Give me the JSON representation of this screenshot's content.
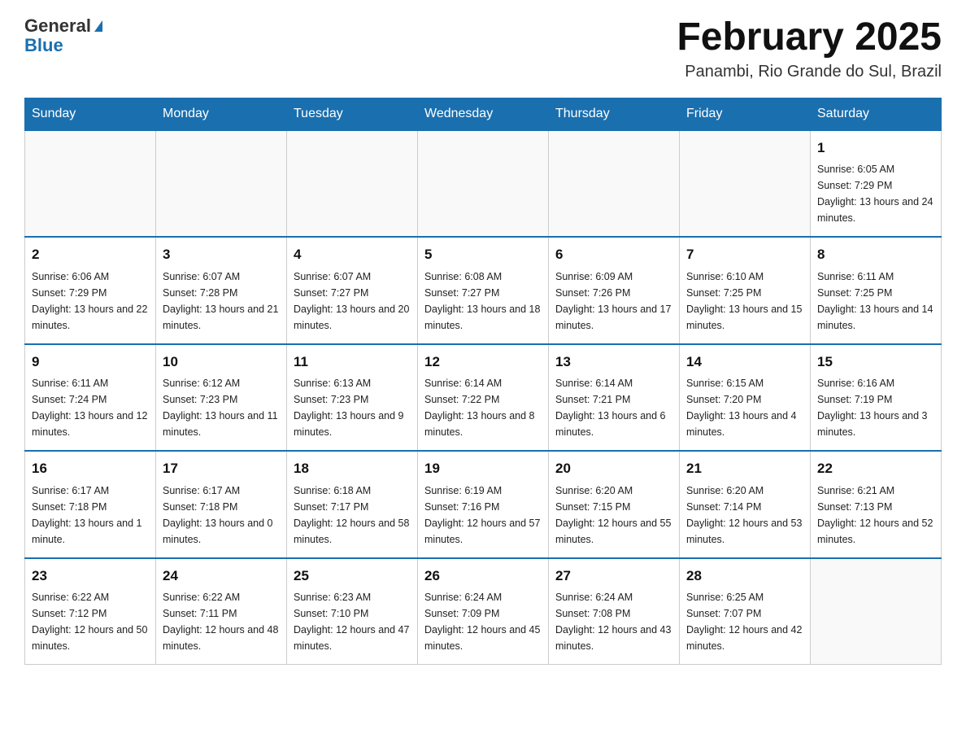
{
  "header": {
    "logo_general": "General",
    "logo_blue": "Blue",
    "title": "February 2025",
    "subtitle": "Panambi, Rio Grande do Sul, Brazil"
  },
  "days_of_week": [
    "Sunday",
    "Monday",
    "Tuesday",
    "Wednesday",
    "Thursday",
    "Friday",
    "Saturday"
  ],
  "weeks": [
    [
      {
        "day": "",
        "info": ""
      },
      {
        "day": "",
        "info": ""
      },
      {
        "day": "",
        "info": ""
      },
      {
        "day": "",
        "info": ""
      },
      {
        "day": "",
        "info": ""
      },
      {
        "day": "",
        "info": ""
      },
      {
        "day": "1",
        "info": "Sunrise: 6:05 AM\nSunset: 7:29 PM\nDaylight: 13 hours and 24 minutes."
      }
    ],
    [
      {
        "day": "2",
        "info": "Sunrise: 6:06 AM\nSunset: 7:29 PM\nDaylight: 13 hours and 22 minutes."
      },
      {
        "day": "3",
        "info": "Sunrise: 6:07 AM\nSunset: 7:28 PM\nDaylight: 13 hours and 21 minutes."
      },
      {
        "day": "4",
        "info": "Sunrise: 6:07 AM\nSunset: 7:27 PM\nDaylight: 13 hours and 20 minutes."
      },
      {
        "day": "5",
        "info": "Sunrise: 6:08 AM\nSunset: 7:27 PM\nDaylight: 13 hours and 18 minutes."
      },
      {
        "day": "6",
        "info": "Sunrise: 6:09 AM\nSunset: 7:26 PM\nDaylight: 13 hours and 17 minutes."
      },
      {
        "day": "7",
        "info": "Sunrise: 6:10 AM\nSunset: 7:25 PM\nDaylight: 13 hours and 15 minutes."
      },
      {
        "day": "8",
        "info": "Sunrise: 6:11 AM\nSunset: 7:25 PM\nDaylight: 13 hours and 14 minutes."
      }
    ],
    [
      {
        "day": "9",
        "info": "Sunrise: 6:11 AM\nSunset: 7:24 PM\nDaylight: 13 hours and 12 minutes."
      },
      {
        "day": "10",
        "info": "Sunrise: 6:12 AM\nSunset: 7:23 PM\nDaylight: 13 hours and 11 minutes."
      },
      {
        "day": "11",
        "info": "Sunrise: 6:13 AM\nSunset: 7:23 PM\nDaylight: 13 hours and 9 minutes."
      },
      {
        "day": "12",
        "info": "Sunrise: 6:14 AM\nSunset: 7:22 PM\nDaylight: 13 hours and 8 minutes."
      },
      {
        "day": "13",
        "info": "Sunrise: 6:14 AM\nSunset: 7:21 PM\nDaylight: 13 hours and 6 minutes."
      },
      {
        "day": "14",
        "info": "Sunrise: 6:15 AM\nSunset: 7:20 PM\nDaylight: 13 hours and 4 minutes."
      },
      {
        "day": "15",
        "info": "Sunrise: 6:16 AM\nSunset: 7:19 PM\nDaylight: 13 hours and 3 minutes."
      }
    ],
    [
      {
        "day": "16",
        "info": "Sunrise: 6:17 AM\nSunset: 7:18 PM\nDaylight: 13 hours and 1 minute."
      },
      {
        "day": "17",
        "info": "Sunrise: 6:17 AM\nSunset: 7:18 PM\nDaylight: 13 hours and 0 minutes."
      },
      {
        "day": "18",
        "info": "Sunrise: 6:18 AM\nSunset: 7:17 PM\nDaylight: 12 hours and 58 minutes."
      },
      {
        "day": "19",
        "info": "Sunrise: 6:19 AM\nSunset: 7:16 PM\nDaylight: 12 hours and 57 minutes."
      },
      {
        "day": "20",
        "info": "Sunrise: 6:20 AM\nSunset: 7:15 PM\nDaylight: 12 hours and 55 minutes."
      },
      {
        "day": "21",
        "info": "Sunrise: 6:20 AM\nSunset: 7:14 PM\nDaylight: 12 hours and 53 minutes."
      },
      {
        "day": "22",
        "info": "Sunrise: 6:21 AM\nSunset: 7:13 PM\nDaylight: 12 hours and 52 minutes."
      }
    ],
    [
      {
        "day": "23",
        "info": "Sunrise: 6:22 AM\nSunset: 7:12 PM\nDaylight: 12 hours and 50 minutes."
      },
      {
        "day": "24",
        "info": "Sunrise: 6:22 AM\nSunset: 7:11 PM\nDaylight: 12 hours and 48 minutes."
      },
      {
        "day": "25",
        "info": "Sunrise: 6:23 AM\nSunset: 7:10 PM\nDaylight: 12 hours and 47 minutes."
      },
      {
        "day": "26",
        "info": "Sunrise: 6:24 AM\nSunset: 7:09 PM\nDaylight: 12 hours and 45 minutes."
      },
      {
        "day": "27",
        "info": "Sunrise: 6:24 AM\nSunset: 7:08 PM\nDaylight: 12 hours and 43 minutes."
      },
      {
        "day": "28",
        "info": "Sunrise: 6:25 AM\nSunset: 7:07 PM\nDaylight: 12 hours and 42 minutes."
      },
      {
        "day": "",
        "info": ""
      }
    ]
  ]
}
